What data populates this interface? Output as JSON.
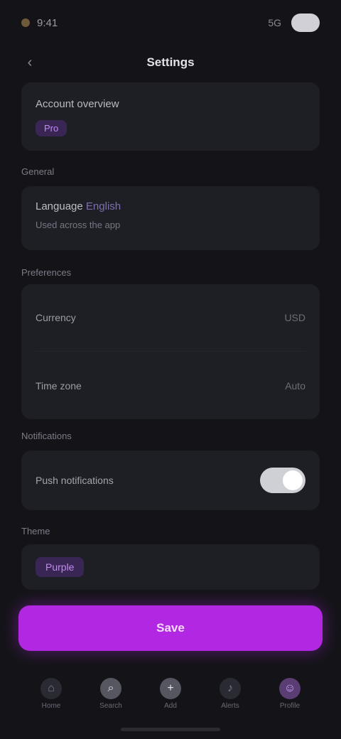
{
  "status_bar": {
    "time": "9:41",
    "network": "5G"
  },
  "header": {
    "title": "Settings",
    "back_icon": "chevron-left-icon"
  },
  "card_a": {
    "line1": "Account overview",
    "chip": "Pro"
  },
  "sections": {
    "s1": "General",
    "s2": "Preferences",
    "s3": "Notifications",
    "s4": "Theme"
  },
  "card_b": {
    "title": "Language",
    "title_accent": "English",
    "subtitle": "Used across the app"
  },
  "card_c": {
    "rows": [
      {
        "label": "Currency",
        "value": "USD"
      },
      {
        "label": "Time zone",
        "value": "Auto"
      }
    ]
  },
  "card_d": {
    "text": "Push notifications",
    "toggle_on": true
  },
  "card_e": {
    "chip": "Purple"
  },
  "primary_button": {
    "label": "Save"
  },
  "bottom_nav": {
    "items": [
      {
        "icon": "home-icon",
        "glyph": "⌂",
        "label": "Home"
      },
      {
        "icon": "search-icon",
        "glyph": "⌕",
        "label": "Search"
      },
      {
        "icon": "plus-icon",
        "glyph": "+",
        "label": "Add"
      },
      {
        "icon": "bell-icon",
        "glyph": "♪",
        "label": "Alerts"
      },
      {
        "icon": "user-icon",
        "glyph": "☺",
        "label": "Profile"
      }
    ]
  },
  "colors": {
    "accent": "#b227e2",
    "background": "#141418",
    "card": "#1e1f25"
  }
}
